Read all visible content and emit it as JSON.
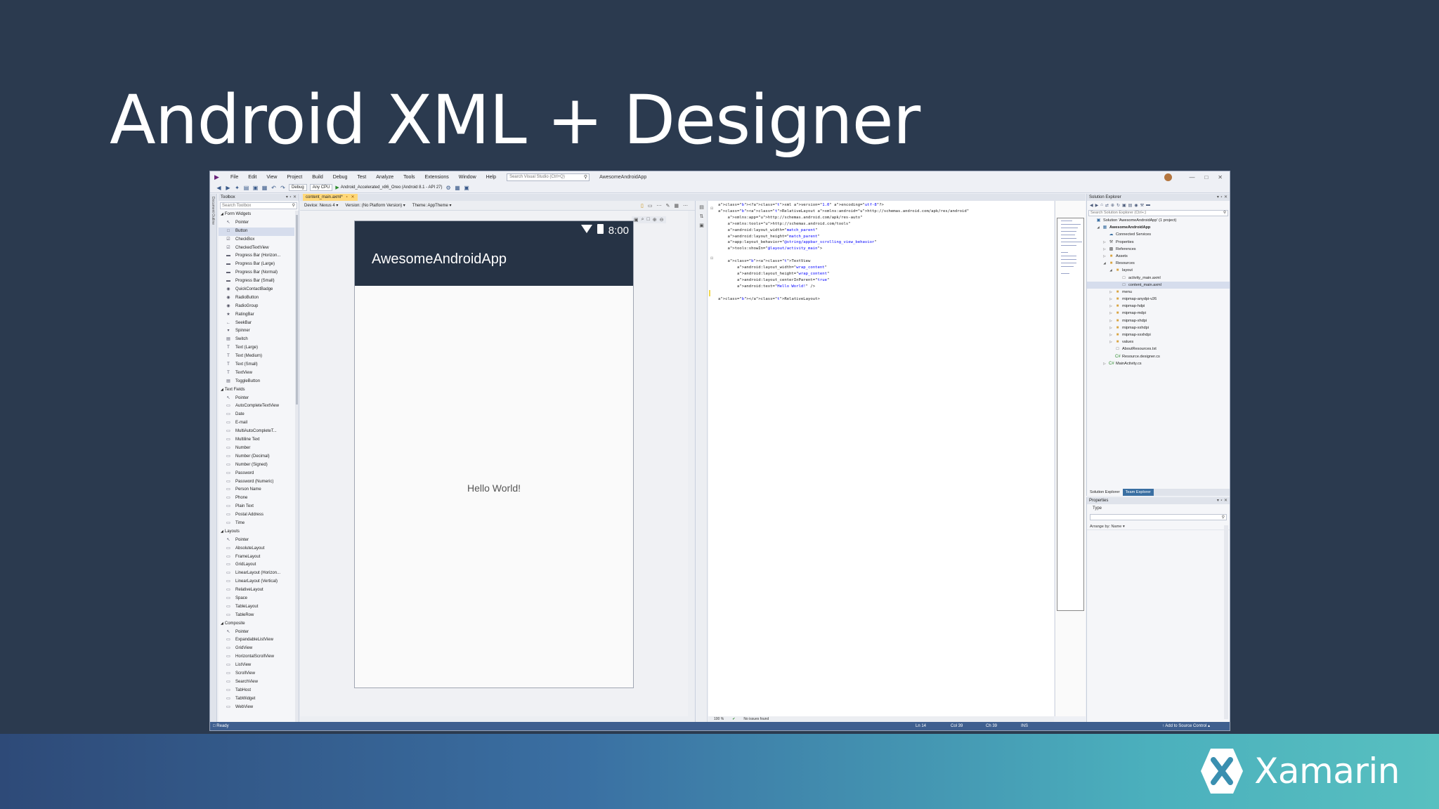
{
  "slide": {
    "title": "Android XML + Designer",
    "brand": "Xamarin"
  },
  "ide": {
    "menu": [
      "File",
      "Edit",
      "View",
      "Project",
      "Build",
      "Debug",
      "Test",
      "Analyze",
      "Tools",
      "Extensions",
      "Window",
      "Help"
    ],
    "search_placeholder": "Search Visual Studio (Ctrl+Q)",
    "project_name": "AwesomeAndroidApp",
    "toolbar": {
      "config": "Debug",
      "platform": "Any CPU",
      "run_target": "Android_Accelerated_x86_Oreo (Android 8.1 - API 27)"
    },
    "toolbox": {
      "title": "Toolbox",
      "search_placeholder": "Search Toolbox",
      "categories": [
        {
          "name": "Form Widgets",
          "items": [
            "Pointer",
            "Button",
            "CheckBox",
            "CheckedTextView",
            "Progress Bar (Horizon...",
            "Progress Bar (Large)",
            "Progress Bar (Normal)",
            "Progress Bar (Small)",
            "QuickContactBadge",
            "RadioButton",
            "RadioGroup",
            "RatingBar",
            "SeekBar",
            "Spinner",
            "Switch",
            "Text (Large)",
            "Text (Medium)",
            "Text (Small)",
            "TextView",
            "ToggleButton"
          ]
        },
        {
          "name": "Text Fields",
          "items": [
            "Pointer",
            "AutoCompleteTextView",
            "Date",
            "E-mail",
            "MultiAutoCompleteT...",
            "Multiline Text",
            "Number",
            "Number (Decimal)",
            "Number (Signed)",
            "Password",
            "Password (Numeric)",
            "Person Name",
            "Phone",
            "Plain Text",
            "Postal Address",
            "Time"
          ]
        },
        {
          "name": "Layouts",
          "items": [
            "Pointer",
            "AbsoluteLayout",
            "FrameLayout",
            "GridLayout",
            "LinearLayout (Horizon...",
            "LinearLayout (Vertical)",
            "RelativeLayout",
            "Space",
            "TableLayout",
            "TableRow"
          ]
        },
        {
          "name": "Composite",
          "items": [
            "Pointer",
            "ExpandableListView",
            "GridView",
            "HorizontalScrollView",
            "ListView",
            "ScrollView",
            "SearchView",
            "TabHost",
            "TabWidget",
            "WebView"
          ]
        }
      ]
    },
    "doc_tab": "content_main.axml*",
    "designer": {
      "device_label": "Device:",
      "device": "Nexus 4",
      "version_label": "Version:",
      "version": "(No Platform Version)",
      "theme_label": "Theme:",
      "theme": "AppTheme",
      "phone_time": "8:00",
      "app_title": "AwesomeAndroidApp",
      "hello_text": "Hello World!",
      "zoom": "100 %",
      "issues": "No issues found"
    },
    "code_lines": [
      "<?xml version=\"1.0\" encoding=\"utf-8\"?>",
      "<RelativeLayout xmlns:android=\"http://schemas.android.com/apk/res/android\"",
      "    xmlns:app=\"http://schemas.android.com/apk/res-auto\"",
      "    xmlns:tools=\"http://schemas.android.com/tools\"",
      "    android:layout_width=\"match_parent\"",
      "    android:layout_height=\"match_parent\"",
      "    app:layout_behavior=\"@string/appbar_scrolling_view_behavior\"",
      "    tools:showIn=\"@layout/activity_main\">",
      "",
      "    <TextView",
      "        android:layout_width=\"wrap_content\"",
      "        android:layout_height=\"wrap_content\"",
      "        android:layout_centerInParent=\"true\"",
      "        android:text=\"Hello World!\" />",
      "",
      "</RelativeLayout>"
    ],
    "solution_explorer": {
      "title": "Solution Explorer",
      "search_placeholder": "Search Solution Explorer (Ctrl+;)",
      "tree": [
        {
          "label": "Solution 'AwesomeAndroidApp' (1 project)",
          "icon": "solution"
        },
        {
          "label": "AwesomeAndroidApp",
          "icon": "project"
        },
        {
          "label": "Connected Services",
          "icon": "services"
        },
        {
          "label": "Properties",
          "icon": "wrench"
        },
        {
          "label": "References",
          "icon": "references"
        },
        {
          "label": "Assets",
          "icon": "folder"
        },
        {
          "label": "Resources",
          "icon": "folder"
        },
        {
          "label": "layout",
          "icon": "folder"
        },
        {
          "label": "activity_main.axml",
          "icon": "file"
        },
        {
          "label": "content_main.axml",
          "icon": "file"
        },
        {
          "label": "menu",
          "icon": "folder"
        },
        {
          "label": "mipmap-anydpi-v26",
          "icon": "folder"
        },
        {
          "label": "mipmap-hdpi",
          "icon": "folder"
        },
        {
          "label": "mipmap-mdpi",
          "icon": "folder"
        },
        {
          "label": "mipmap-xhdpi",
          "icon": "folder"
        },
        {
          "label": "mipmap-xxhdpi",
          "icon": "folder"
        },
        {
          "label": "mipmap-xxxhdpi",
          "icon": "folder"
        },
        {
          "label": "values",
          "icon": "folder"
        },
        {
          "label": "AboutResources.txt",
          "icon": "file"
        },
        {
          "label": "Resource.designer.cs",
          "icon": "cs"
        },
        {
          "label": "MainActivity.cs",
          "icon": "cs"
        }
      ],
      "tabs": [
        "Solution Explorer",
        "Team Explorer"
      ]
    },
    "properties": {
      "title": "Properties",
      "type_label": "Type",
      "arrange": "Arrange by: Name"
    },
    "status": {
      "ready": "Ready",
      "ln": "Ln 14",
      "col": "Col 39",
      "ch": "Ch 39",
      "mode": "INS",
      "source_control": "Add to Source Control"
    }
  }
}
